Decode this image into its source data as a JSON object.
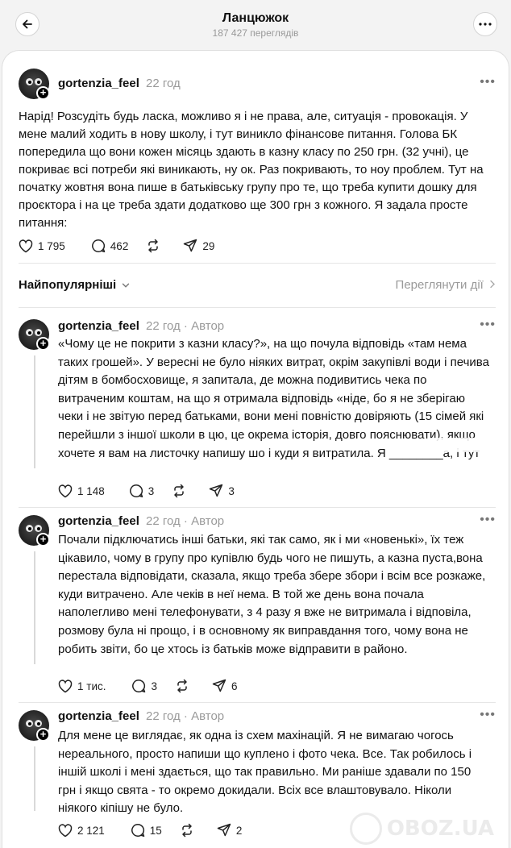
{
  "header": {
    "title": "Ланцюжок",
    "views": "187 427 переглядів"
  },
  "main_post": {
    "username": "gortenzia_feel",
    "time": "22 год",
    "text": "Нарід! Розсудіть будь ласка, можливо я і не права, але, ситуація - провокація. У мене малий ходить в нову школу, і тут виникло фінансове питання. Голова БК попередила що вони кожен місяць здають в казну класу по 250 грн. (32 учні), це покриває всі потреби які виникають, ну ок. Раз покривають, то ноу проблем. Тут на початку жовтня вона пише в батьківську групу про те, що треба купити дошку для проєктора і на це треба здати додатково ще 300 грн з кожного. Я задала просте питання:",
    "likes": "1 795",
    "comments": "462",
    "reposts": "",
    "shares": "29"
  },
  "sort": {
    "label": "Найпопулярніші",
    "activity": "Переглянути дії"
  },
  "replies": [
    {
      "username": "gortenzia_feel",
      "time": "22 год",
      "author": "Автор",
      "text": "«Чому це не покрити з казни класу?», на що почула відповідь «там нема таких грошей». У вересні не було ніяких витрат, окрім закупівлі води і печива дітям в бомбосховище, я запитала, де можна подивитись чека по витраченим коштам, на що я отримала відповідь «ніде, бо я не зберігаю чеки і не звітую перед батьками, вони мені повністю довіряють (15 сімей які перейшли з іншої школи в цю, це окрема історія, довго пояснювати), якщо хочете я вам на листочку напишу шо і куди я витратила. Я ________а, і тут",
      "likes": "1 148",
      "comments": "3",
      "shares": "3"
    },
    {
      "username": "gortenzia_feel",
      "time": "22 год",
      "author": "Автор",
      "text": "Почали підключатись інші батьки, які так само, як і ми «новенькі», їх теж цікавило, чому в групу про купівлю будь чого не пишуть, а казна пуста,вона перестала відповідати, сказала, якщо треба збере збори і всім все розкаже, куди витрачено. Але чеків в неї нема. В той же день вона почала наполегливо мені телефонувати, з 4 разу я вже не витримала і відповіла, розмову була ні прощо, і в основному як виправдання того, чому вона не робить звіти, бо це хтось із батьків може відправити в районо.",
      "likes": "1 тис.",
      "comments": "3",
      "shares": "6"
    },
    {
      "username": "gortenzia_feel",
      "time": "22 год",
      "author": "Автор",
      "text": "Для мене це виглядає, як одна із схем махінацій. Я не вимагаю чогось нереального, просто напиши що куплено і фото чека. Все. Так робилось і іншій школі і мені здається, що так правильно. Ми раніше здавали по 150 грн і якщо свята - то окремо докидали. Всіх все влаштовувало. Ніколи ніякого кіпішу не було.",
      "likes": "2 121",
      "comments": "15",
      "shares": "2"
    }
  ],
  "watermark": "OBOZ.UA"
}
